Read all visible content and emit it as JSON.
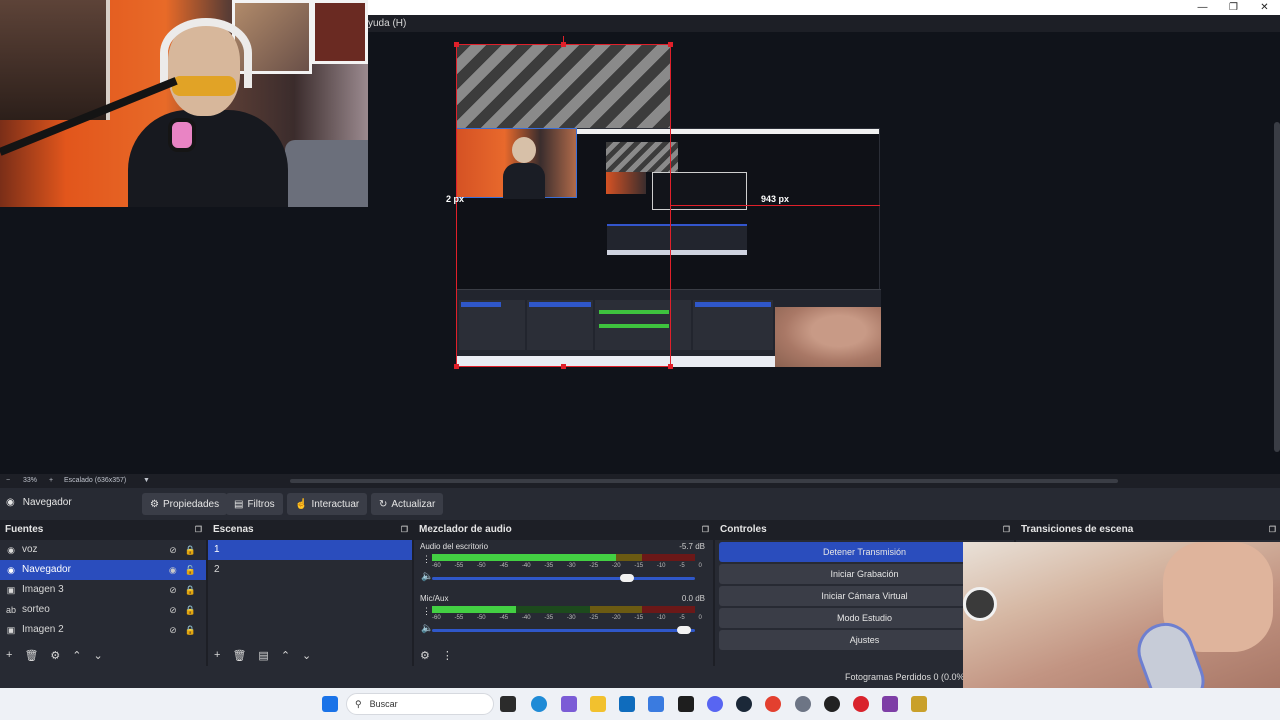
{
  "menubar": {
    "help_label": "yuda (H)"
  },
  "preview": {
    "left_distance": "2 px",
    "right_distance": "943 px",
    "zoom": "33%",
    "scale_label": "Escalado (636x357)"
  },
  "source_toolbar": {
    "source_name": "Navegador",
    "properties": "Propiedades",
    "filters": "Filtros",
    "interact": "Interactuar",
    "refresh": "Actualizar"
  },
  "sources": {
    "title": "Fuentes",
    "items": [
      {
        "label": "voz",
        "icon": "audio-icon",
        "selected": false
      },
      {
        "label": "Navegador",
        "icon": "globe-icon",
        "selected": true
      },
      {
        "label": "Imagen 3",
        "icon": "image-icon",
        "selected": false
      },
      {
        "label": "sorteo",
        "icon": "text-icon",
        "selected": false
      },
      {
        "label": "Imagen 2",
        "icon": "image-icon",
        "selected": false
      }
    ]
  },
  "scenes": {
    "title": "Escenas",
    "items": [
      {
        "label": "1",
        "selected": true
      },
      {
        "label": "2",
        "selected": false
      }
    ]
  },
  "mixer": {
    "title": "Mezclador de audio",
    "channels": [
      {
        "name": "Audio del escritorio",
        "db": "-5.7 dB",
        "level": 0.7,
        "volume": 0.74
      },
      {
        "name": "Mic/Aux",
        "db": "0.0 dB",
        "level": 0.32,
        "volume": 0.96
      }
    ],
    "ticks": [
      "-60",
      "-55",
      "-50",
      "-45",
      "-40",
      "-35",
      "-30",
      "-25",
      "-20",
      "-15",
      "-10",
      "-5",
      "0"
    ]
  },
  "controls": {
    "title": "Controles",
    "buttons": [
      "Detener Transmisión",
      "Iniciar Grabación",
      "Iniciar Cámara Virtual",
      "Modo Estudio",
      "Ajustes"
    ]
  },
  "transitions": {
    "title": "Transiciones de escena"
  },
  "status": {
    "frames_lost": "Fotogramas Perdidos 0 (0.0%)"
  },
  "taskbar": {
    "search_placeholder": "Buscar"
  },
  "colors": {
    "accent": "#2a4dbd",
    "guide_red": "#e0202a",
    "dock_bg": "#272a33",
    "panel_bg": "#1d1f26"
  }
}
